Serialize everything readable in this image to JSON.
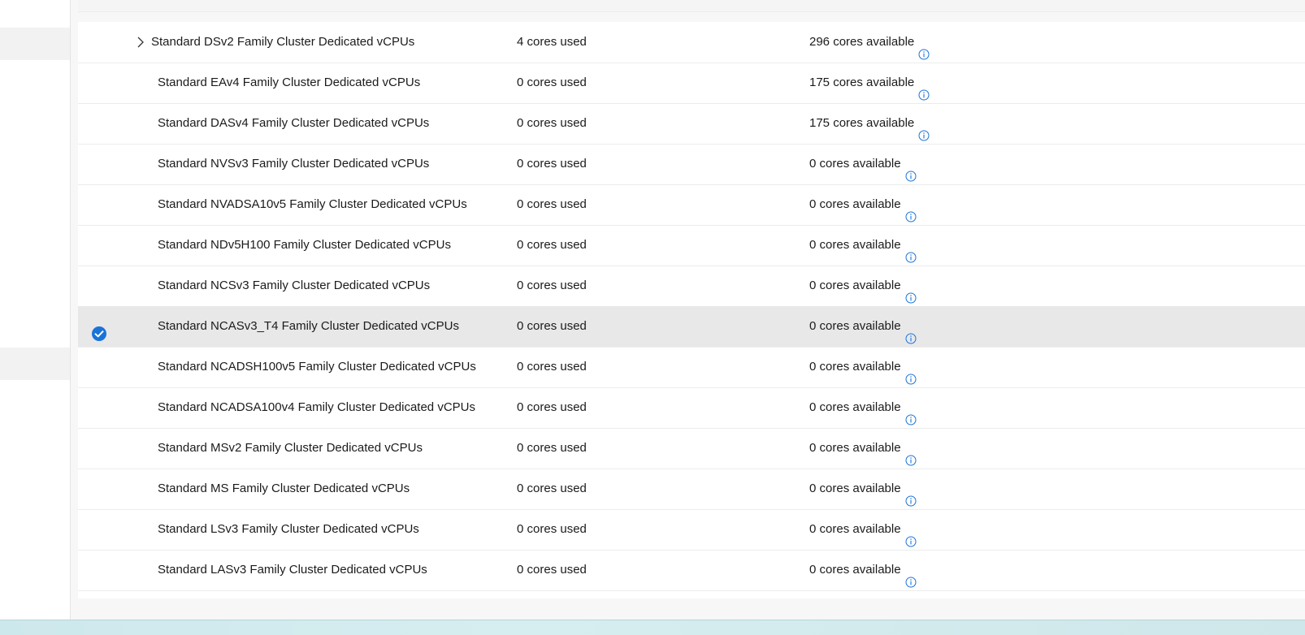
{
  "quota_rows": [
    {
      "name": "Standard DSv2 Family Cluster Dedicated vCPUs",
      "used": "4 cores used",
      "available": "296 cores available",
      "expandable": true,
      "selected": false
    },
    {
      "name": "Standard EAv4 Family Cluster Dedicated vCPUs",
      "used": "0 cores used",
      "available": "175 cores available",
      "expandable": false,
      "selected": false
    },
    {
      "name": "Standard DASv4 Family Cluster Dedicated vCPUs",
      "used": "0 cores used",
      "available": "175 cores available",
      "expandable": false,
      "selected": false
    },
    {
      "name": "Standard NVSv3 Family Cluster Dedicated vCPUs",
      "used": "0 cores used",
      "available": "0 cores available",
      "expandable": false,
      "selected": false
    },
    {
      "name": "Standard NVADSA10v5 Family Cluster Dedicated vCPUs",
      "used": "0 cores used",
      "available": "0 cores available",
      "expandable": false,
      "selected": false
    },
    {
      "name": "Standard NDv5H100 Family Cluster Dedicated vCPUs",
      "used": "0 cores used",
      "available": "0 cores available",
      "expandable": false,
      "selected": false
    },
    {
      "name": "Standard NCSv3 Family Cluster Dedicated vCPUs",
      "used": "0 cores used",
      "available": "0 cores available",
      "expandable": false,
      "selected": false
    },
    {
      "name": "Standard NCASv3_T4 Family Cluster Dedicated vCPUs",
      "used": "0 cores used",
      "available": "0 cores available",
      "expandable": false,
      "selected": true
    },
    {
      "name": "Standard NCADSH100v5 Family Cluster Dedicated vCPUs",
      "used": "0 cores used",
      "available": "0 cores available",
      "expandable": false,
      "selected": false
    },
    {
      "name": "Standard NCADSA100v4 Family Cluster Dedicated vCPUs",
      "used": "0 cores used",
      "available": "0 cores available",
      "expandable": false,
      "selected": false
    },
    {
      "name": "Standard MSv2 Family Cluster Dedicated vCPUs",
      "used": "0 cores used",
      "available": "0 cores available",
      "expandable": false,
      "selected": false
    },
    {
      "name": "Standard MS Family Cluster Dedicated vCPUs",
      "used": "0 cores used",
      "available": "0 cores available",
      "expandable": false,
      "selected": false
    },
    {
      "name": "Standard LSv3 Family Cluster Dedicated vCPUs",
      "used": "0 cores used",
      "available": "0 cores available",
      "expandable": false,
      "selected": false
    },
    {
      "name": "Standard LASv3 Family Cluster Dedicated vCPUs",
      "used": "0 cores used",
      "available": "0 cores available",
      "expandable": false,
      "selected": false
    }
  ],
  "colors": {
    "accent": "#1a73d9",
    "selected_row": "#e8e8e8",
    "row_border": "#ececec"
  },
  "icons": {
    "expand": "chevron-right-icon",
    "selected": "check-circle-icon",
    "info": "info-icon"
  }
}
